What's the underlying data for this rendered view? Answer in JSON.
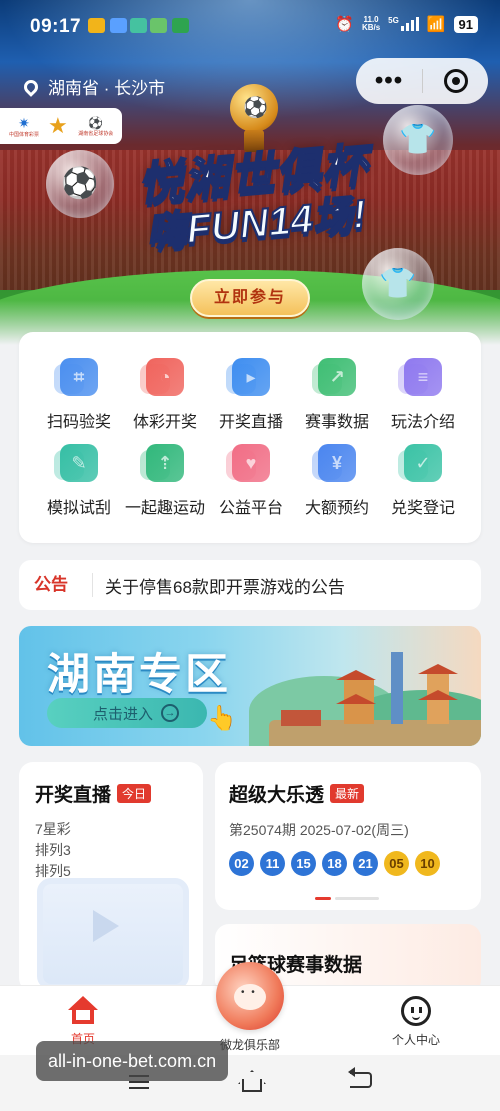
{
  "status_bar": {
    "time": "09:17",
    "net_speed_value": "11.0",
    "net_speed_unit": "KB/s",
    "network": "5G",
    "battery": "91"
  },
  "header": {
    "location": "湖南省 · 长沙市",
    "capsule_more": "•••"
  },
  "banner": {
    "headline_line1": "悦湘世俱杯",
    "headline_line2": "嗨FUN14场!",
    "cta": "立即参与",
    "logo_text_1": "中国体育彩票",
    "logo_text_2": "湖南省足球协会"
  },
  "functions": [
    {
      "label": "扫码验奖",
      "icon": "scan-icon",
      "color": "#4b8fef"
    },
    {
      "label": "体彩开奖",
      "icon": "draw-icon",
      "color": "#f0645d"
    },
    {
      "label": "开奖直播",
      "icon": "live-icon",
      "color": "#3f8ef0"
    },
    {
      "label": "赛事数据",
      "icon": "chart-icon",
      "color": "#3fbe74"
    },
    {
      "label": "玩法介绍",
      "icon": "doc-icon",
      "color": "#8f79ef"
    },
    {
      "label": "模拟试刮",
      "icon": "scratch-icon",
      "color": "#36bfa5"
    },
    {
      "label": "一起趣运动",
      "icon": "sport-icon",
      "color": "#32b87c"
    },
    {
      "label": "公益平台",
      "icon": "heart-icon",
      "color": "#f16e86"
    },
    {
      "label": "大额预约",
      "icon": "yuan-icon",
      "color": "#4b86ef"
    },
    {
      "label": "兑奖登记",
      "icon": "register-icon",
      "color": "#3cc3a6"
    }
  ],
  "notice": {
    "tag": "公告",
    "text": "关于停售68款即开票游戏的公告"
  },
  "hunan_zone": {
    "title": "湖南专区",
    "enter_label": "点击进入"
  },
  "live_card": {
    "title": "开奖直播",
    "badge": "今日",
    "games": [
      "7星彩",
      "排列3",
      "排列5"
    ]
  },
  "lotto_card": {
    "title": "超级大乐透",
    "badge": "最新",
    "period": "第25074期 2025-07-02(周三)",
    "front_numbers": [
      "02",
      "11",
      "15",
      "18",
      "21"
    ],
    "back_numbers": [
      "05",
      "10"
    ],
    "front_color": "#2e74d6",
    "back_color": "#f0b81e",
    "pager_active": 0,
    "pager_total": 2
  },
  "football_card": {
    "title": "足篮球赛事数据"
  },
  "tab_bar": {
    "home": "首页",
    "club": "微龙俱乐部",
    "profile": "个人中心",
    "active_color": "#e53a2e"
  },
  "watermark": "all-in-one-bet.com.cn"
}
